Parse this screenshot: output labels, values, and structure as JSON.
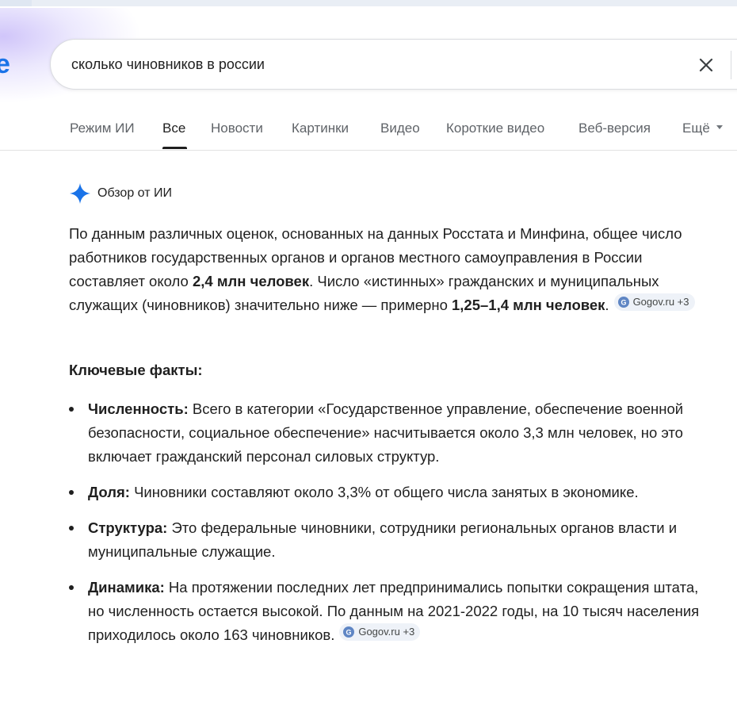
{
  "search": {
    "query": "сколько чиновников в россии",
    "clear_icon": "close-icon"
  },
  "tabs": [
    {
      "label": "Режим ИИ"
    },
    {
      "label": "Все"
    },
    {
      "label": "Новости"
    },
    {
      "label": "Картинки"
    },
    {
      "label": "Видео"
    },
    {
      "label": "Короткие видео"
    },
    {
      "label": "Веб-версия"
    },
    {
      "label": "Ещё"
    }
  ],
  "active_tab": "Все",
  "ai_overview": {
    "title": "Обзор от ИИ",
    "icon": "sparkle-icon",
    "accent_color": "#1a73e8",
    "intro_part1": "По данным различных оценок, основанных на данных Росстата и Минфина, общее число работников государственных органов и органов местного самоуправления в России составляет около ",
    "intro_bold1": "2,4 млн человек",
    "intro_part2": ". Число «истинных» гражданских и муниципальных служащих (чиновников) значительно ниже — примерно ",
    "intro_bold2": "1,25–1,4 млн человек",
    "intro_part3": ".",
    "intro_source": "Gogov.ru +3",
    "facts_heading": "Ключевые факты:",
    "facts": [
      {
        "title": "Численность:",
        "text": " Всего в категории «Государственное управление, обеспечение военной безопасности, социальное обеспечение» насчитывается около 3,3 млн человек, но это включает гражданский персонал силовых структур."
      },
      {
        "title": "Доля:",
        "text": " Чиновники составляют около 3,3% от общего числа занятых в экономике."
      },
      {
        "title": "Структура:",
        "text": " Это федеральные чиновники, сотрудники региональных органов власти и муниципальные служащие."
      },
      {
        "title": "Динамика:",
        "text": " На протяжении последних лет предпринимались попытки сокращения штата, но численность остается высокой. По данным на 2021-2022 годы, на 10 тысяч населения приходилось около 163 чиновников.",
        "source": "Gogov.ru +3"
      }
    ]
  }
}
